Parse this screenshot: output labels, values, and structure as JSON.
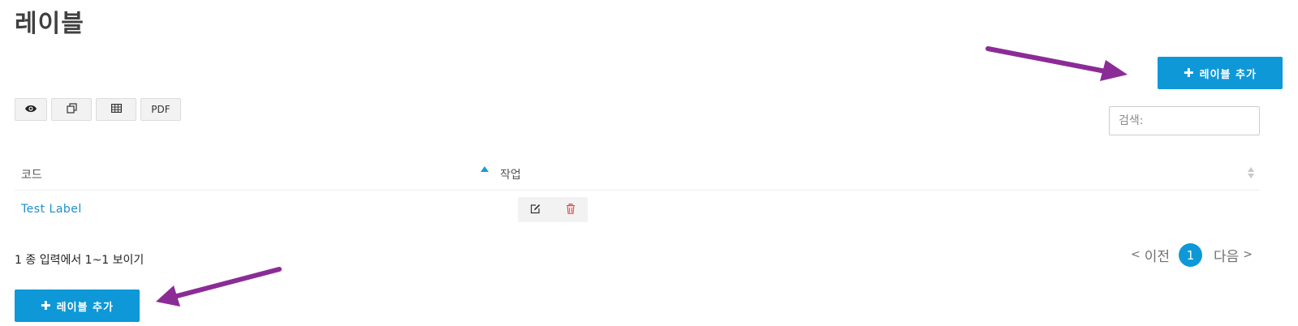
{
  "page": {
    "title": "레이블"
  },
  "toolbar": {
    "add_label": "레이블 추가",
    "add_icon": "plus-icon",
    "exports": [
      {
        "icon": "eye-icon"
      },
      {
        "icon": "copy-icon"
      },
      {
        "icon": "table-icon"
      },
      {
        "label": "PDF"
      }
    ]
  },
  "search": {
    "placeholder": "검색:"
  },
  "table": {
    "columns": [
      "코드",
      "작업"
    ],
    "sort": {
      "column": "코드",
      "direction": "asc"
    },
    "rows": [
      {
        "code": "Test Label",
        "actions": [
          "edit-icon",
          "trash-icon"
        ]
      }
    ]
  },
  "footer": {
    "info": "1 종 입력에서 1~1 보이기",
    "prev": "이전",
    "next": "다음",
    "current_page": "1"
  },
  "colors": {
    "primary": "#0e98d8",
    "link": "#1a8fcd",
    "danger": "#e04848",
    "annotation_arrow": "#8b2c96"
  }
}
